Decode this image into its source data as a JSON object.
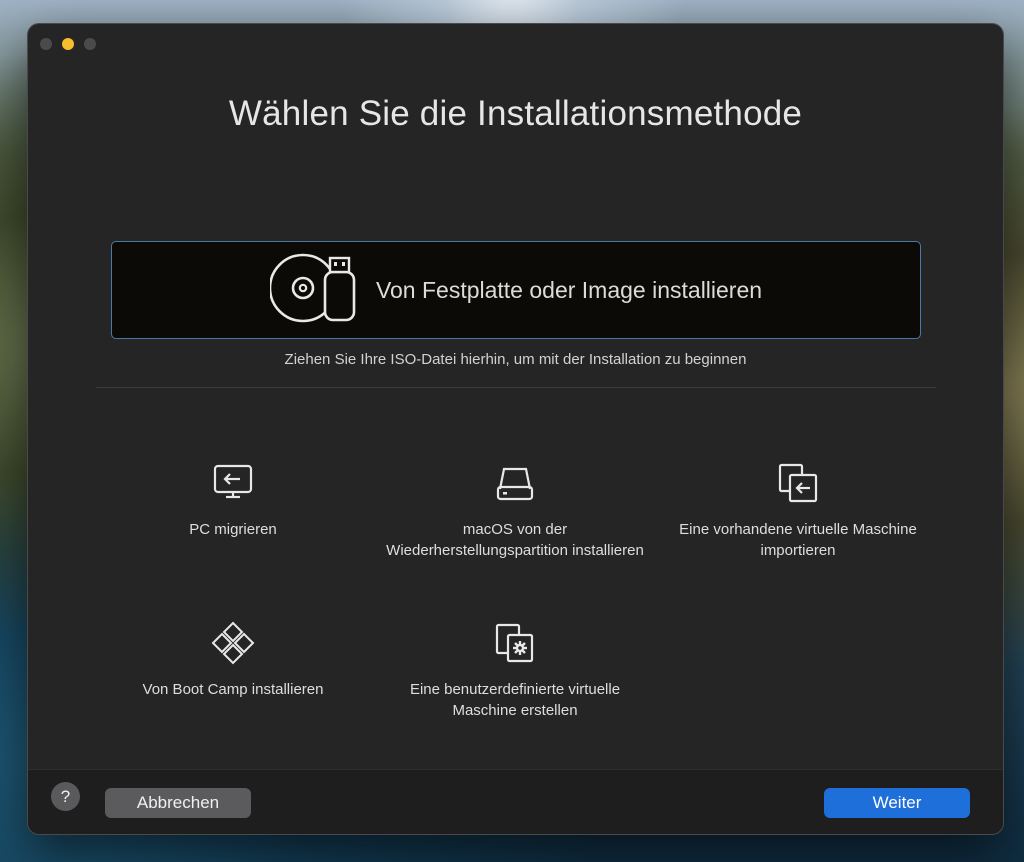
{
  "window": {
    "title": "Wählen Sie die Installationsmethode"
  },
  "drop_zone": {
    "label": "Von Festplatte oder Image installieren",
    "icon": "disc-usb-icon",
    "hint": "Ziehen Sie Ihre ISO-Datei hierhin, um mit der Installation zu beginnen"
  },
  "options": [
    {
      "label": "PC migrieren",
      "icon": "monitor-import-icon"
    },
    {
      "label": "macOS von der Wiederherstellungspartition installieren",
      "icon": "hard-drive-icon"
    },
    {
      "label": "Eine vorhandene virtuelle Maschine importieren",
      "icon": "import-vm-icon"
    },
    {
      "label": "Von Boot Camp installieren",
      "icon": "windows-diamond-icon"
    },
    {
      "label": "Eine benutzerdefinierte virtuelle Maschine erstellen",
      "icon": "gear-window-icon"
    }
  ],
  "footer": {
    "help_label": "?",
    "cancel_label": "Abbrechen",
    "next_label": "Weiter"
  },
  "colors": {
    "accent": "#1e6fd9",
    "window_bg": "#252526",
    "minimize": "#f6bd2d"
  }
}
